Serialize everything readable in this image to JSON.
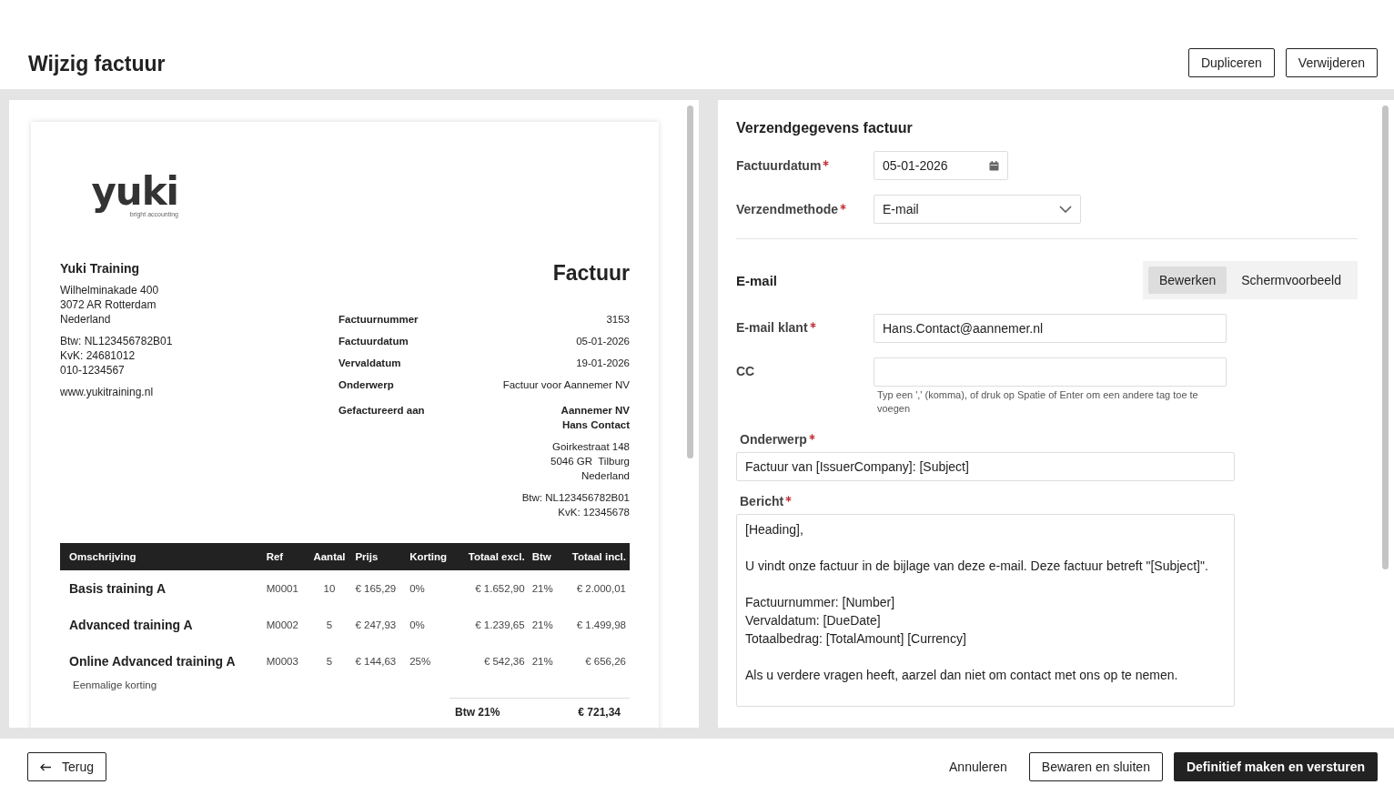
{
  "page_title": "Wijzig factuur",
  "header_buttons": [
    "Dupliceren",
    "Verwijderen"
  ],
  "invoice": {
    "logo": {
      "word": "yuki",
      "tagline": "bright accounting"
    },
    "sender": {
      "name": "Yuki Training",
      "address": [
        "Wilhelminakade 400",
        "3072 AR Rotterdam",
        "Nederland"
      ],
      "ids": [
        "Btw: NL123456782B01",
        "KvK: 24681012",
        "010-1234567"
      ],
      "website": "www.yukitraining.nl"
    },
    "title": "Factuur",
    "meta": [
      {
        "label": "Factuurnummer",
        "value": "3153"
      },
      {
        "label": "Factuurdatum",
        "value": "05-01-2026"
      },
      {
        "label": "Vervaldatum",
        "value": "19-01-2026"
      },
      {
        "label": "Onderwerp",
        "value": "Factuur voor Aannemer NV"
      }
    ],
    "billed_to": {
      "label": "Gefactureerd aan",
      "names": [
        "Aannemer NV",
        "Hans Contact"
      ],
      "address": [
        "Goirkestraat 148",
        "5046 GR  Tilburg",
        "Nederland"
      ],
      "ids": [
        "Btw: NL123456782B01",
        "KvK: 12345678"
      ]
    },
    "table": {
      "columns": [
        "Omschrijving",
        "Ref",
        "Aantal",
        "Prijs",
        "Korting",
        "Totaal excl.",
        "Btw",
        "Totaal incl."
      ],
      "rows": [
        {
          "cells": [
            "Basis training A",
            "M0001",
            "10",
            "€ 165,29",
            "0%",
            "€ 1.652,90",
            "21%",
            "€ 2.000,01"
          ]
        },
        {
          "cells": [
            "Advanced training A",
            "M0002",
            "5",
            "€ 247,93",
            "0%",
            "€ 1.239,65",
            "21%",
            "€ 1.499,98"
          ]
        },
        {
          "cells": [
            "Online Advanced training A",
            "M0003",
            "5",
            "€ 144,63",
            "25%",
            "€ 542,36",
            "21%",
            "€ 656,26"
          ],
          "note": "Eenmalige korting"
        }
      ]
    },
    "totals": [
      {
        "label": "Btw 21%",
        "value": "€ 721,34"
      }
    ]
  },
  "form": {
    "section_title": "Verzendgegevens factuur",
    "fields": [
      {
        "kind": "date",
        "label": "Factuurdatum",
        "required": true,
        "value": "05-01-2026"
      },
      {
        "kind": "select",
        "label": "Verzendmethode",
        "required": true,
        "value": "E-mail"
      }
    ],
    "email_title": "E-mail",
    "tabs": [
      {
        "label": "Bewerken",
        "selected": true
      },
      {
        "label": "Schermvoorbeeld",
        "selected": false
      }
    ],
    "email_fields": [
      {
        "label": "E-mail klant",
        "required": true,
        "value": "Hans.Contact@aannemer.nl"
      },
      {
        "label": "CC",
        "required": false,
        "hint": "Typ een ',' (komma), of druk op Spatie of Enter om een andere tag toe te voegen"
      }
    ],
    "subject": {
      "label": "Onderwerp",
      "required": true,
      "value": "Factuur van [IssuerCompany]: [Subject]"
    },
    "message": {
      "label": "Bericht",
      "required": true,
      "paragraphs": [
        [
          "[Heading],"
        ],
        [
          "U vindt onze factuur in de bijlage van deze e-mail. Deze factuur betreft \"[Subject]\"."
        ],
        [
          "Factuurnummer: [Number]",
          "Vervaldatum: [DueDate]",
          "Totaalbedrag: [TotalAmount] [Currency]"
        ],
        [
          "Als u verdere vragen heeft, aarzel dan niet om contact met ons op te nemen."
        ]
      ]
    }
  },
  "footer": {
    "back": "Terug",
    "cancel": "Annuleren",
    "save": "Bewaren en sluiten",
    "finalize": "Definitief maken en versturen"
  }
}
